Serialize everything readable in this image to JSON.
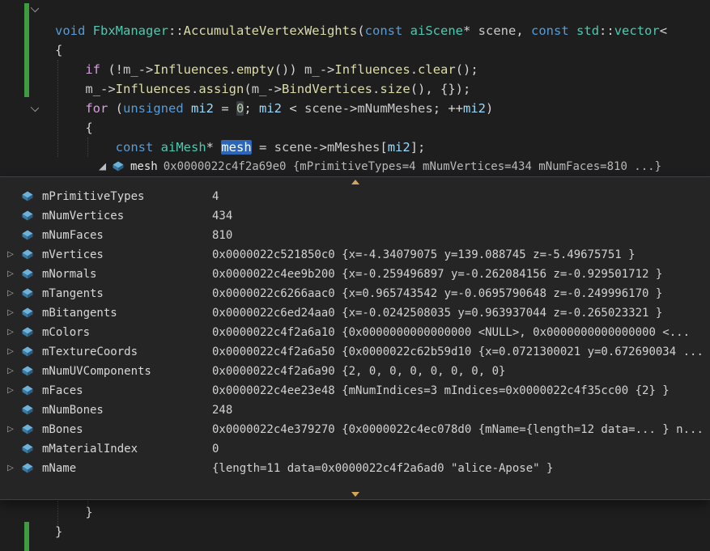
{
  "colors": {
    "editor_bg": "#1e1e1e",
    "popup_bg": "#252526",
    "popup_border": "#3f3f46",
    "change_bar_green": "#3f9b3f",
    "scroll_arrow_orange": "#d6a35c",
    "selection_highlight_blue": "#2b66b8",
    "keyword_blue": "#569cd6",
    "control_keyword_purple": "#d8a0df",
    "type_teal": "#4ec9b0",
    "function_yellow": "#dcdcaa",
    "local_var_blue": "#9cdcfe",
    "number_green": "#b5cea8"
  },
  "editor": {
    "top_lines": [
      {
        "tokens": [
          {
            "t": "void",
            "c": "kw"
          },
          {
            "t": " ",
            "c": "pl"
          },
          {
            "t": "FbxManager",
            "c": "type"
          },
          {
            "t": "::",
            "c": "pl"
          },
          {
            "t": "AccumulateVertexWeights",
            "c": "fn"
          },
          {
            "t": "(",
            "c": "pl"
          },
          {
            "t": "const",
            "c": "kw"
          },
          {
            "t": " ",
            "c": "pl"
          },
          {
            "t": "aiScene",
            "c": "type"
          },
          {
            "t": "* ",
            "c": "pl"
          },
          {
            "t": "scene",
            "c": "id"
          },
          {
            "t": ", ",
            "c": "pl"
          },
          {
            "t": "const",
            "c": "kw"
          },
          {
            "t": " ",
            "c": "pl"
          },
          {
            "t": "std",
            "c": "type"
          },
          {
            "t": "::",
            "c": "pl"
          },
          {
            "t": "vector",
            "c": "type"
          },
          {
            "t": "<",
            "c": "pl"
          }
        ]
      },
      {
        "tokens": [
          {
            "t": "{",
            "c": "pl"
          }
        ]
      },
      {
        "tokens": [
          {
            "t": "    ",
            "c": "pl"
          },
          {
            "t": "if",
            "c": "ctrl"
          },
          {
            "t": " (!",
            "c": "pl"
          },
          {
            "t": "m_",
            "c": "id"
          },
          {
            "t": "->",
            "c": "pl"
          },
          {
            "t": "Influences",
            "c": "fn"
          },
          {
            "t": ".",
            "c": "pl"
          },
          {
            "t": "empty",
            "c": "fn"
          },
          {
            "t": "()) ",
            "c": "pl"
          },
          {
            "t": "m_",
            "c": "id"
          },
          {
            "t": "->",
            "c": "pl"
          },
          {
            "t": "Influences",
            "c": "fn"
          },
          {
            "t": ".",
            "c": "pl"
          },
          {
            "t": "clear",
            "c": "fn"
          },
          {
            "t": "();",
            "c": "pl"
          }
        ]
      },
      {
        "tokens": [
          {
            "t": "    ",
            "c": "pl"
          },
          {
            "t": "m_",
            "c": "id"
          },
          {
            "t": "->",
            "c": "pl"
          },
          {
            "t": "Influences",
            "c": "fn"
          },
          {
            "t": ".",
            "c": "pl"
          },
          {
            "t": "assign",
            "c": "fn"
          },
          {
            "t": "(",
            "c": "pl"
          },
          {
            "t": "m_",
            "c": "id"
          },
          {
            "t": "->",
            "c": "pl"
          },
          {
            "t": "BindVertices",
            "c": "fn"
          },
          {
            "t": ".",
            "c": "pl"
          },
          {
            "t": "size",
            "c": "fn"
          },
          {
            "t": "(), {});",
            "c": "pl"
          }
        ]
      },
      {
        "tokens": [
          {
            "t": "    ",
            "c": "pl"
          },
          {
            "t": "for",
            "c": "ctrl"
          },
          {
            "t": " (",
            "c": "pl"
          },
          {
            "t": "unsigned",
            "c": "kw"
          },
          {
            "t": " ",
            "c": "pl"
          },
          {
            "t": "mi2",
            "c": "var"
          },
          {
            "t": " = ",
            "c": "pl"
          },
          {
            "t": "0",
            "c": "numhl"
          },
          {
            "t": "; ",
            "c": "pl"
          },
          {
            "t": "mi2",
            "c": "var"
          },
          {
            "t": " < ",
            "c": "pl"
          },
          {
            "t": "scene",
            "c": "id"
          },
          {
            "t": "->",
            "c": "pl"
          },
          {
            "t": "mNumMeshes",
            "c": "id"
          },
          {
            "t": "; ++",
            "c": "pl"
          },
          {
            "t": "mi2",
            "c": "var"
          },
          {
            "t": ")",
            "c": "pl"
          }
        ]
      },
      {
        "tokens": [
          {
            "t": "    {",
            "c": "pl"
          }
        ]
      },
      {
        "tokens": [
          {
            "t": "        ",
            "c": "pl"
          },
          {
            "t": "const",
            "c": "kw"
          },
          {
            "t": " ",
            "c": "pl"
          },
          {
            "t": "aiMesh",
            "c": "type"
          },
          {
            "t": "* ",
            "c": "pl"
          },
          {
            "t": "mesh",
            "c": "sel"
          },
          {
            "t": " = ",
            "c": "pl"
          },
          {
            "t": "scene",
            "c": "id"
          },
          {
            "t": "->",
            "c": "pl"
          },
          {
            "t": "mMeshes",
            "c": "id"
          },
          {
            "t": "[",
            "c": "pl"
          },
          {
            "t": "mi2",
            "c": "var"
          },
          {
            "t": "];",
            "c": "pl"
          }
        ]
      }
    ],
    "bottom_lines": [
      {
        "tokens": [
          {
            "t": "    }",
            "c": "pl"
          }
        ]
      },
      {
        "tokens": [
          {
            "t": "}",
            "c": "pl"
          }
        ]
      }
    ]
  },
  "datatip": {
    "header": {
      "name": "mesh",
      "value": "0x0000022c4f2a69e0 {mPrimitiveTypes=4 mNumVertices=434 mNumFaces=810 ...}"
    },
    "icons": {
      "member_icon": "struct-icon",
      "expander_collapsed": "▷",
      "expander_expanded": "lower-right-filled-triangle",
      "scroll_up": "triangle-up",
      "scroll_down": "triangle-down",
      "fold_marker": "chevron-down"
    },
    "members": [
      {
        "name": "mPrimitiveTypes",
        "value": "4",
        "expandable": false
      },
      {
        "name": "mNumVertices",
        "value": "434",
        "expandable": false
      },
      {
        "name": "mNumFaces",
        "value": "810",
        "expandable": false
      },
      {
        "name": "mVertices",
        "value": "0x0000022c521850c0 {x=-4.34079075 y=139.088745 z=-5.49675751 }",
        "expandable": true
      },
      {
        "name": "mNormals",
        "value": "0x0000022c4ee9b200 {x=-0.259496897 y=-0.262084156 z=-0.929501712 }",
        "expandable": true
      },
      {
        "name": "mTangents",
        "value": "0x0000022c6266aac0 {x=0.965743542 y=-0.0695790648 z=-0.249996170 }",
        "expandable": true
      },
      {
        "name": "mBitangents",
        "value": "0x0000022c6ed24aa0 {x=-0.0242508035 y=0.963937044 z=-0.265023321 }",
        "expandable": true
      },
      {
        "name": "mColors",
        "value": "0x0000022c4f2a6a10 {0x0000000000000000 <NULL>, 0x0000000000000000 <...",
        "expandable": true
      },
      {
        "name": "mTextureCoords",
        "value": "0x0000022c4f2a6a50 {0x0000022c62b59d10 {x=0.0721300021 y=0.672690034 ...",
        "expandable": true
      },
      {
        "name": "mNumUVComponents",
        "value": "0x0000022c4f2a6a90 {2, 0, 0, 0, 0, 0, 0, 0}",
        "expandable": true
      },
      {
        "name": "mFaces",
        "value": "0x0000022c4ee23e48 {mNumIndices=3 mIndices=0x0000022c4f35cc00 {2} }",
        "expandable": true
      },
      {
        "name": "mNumBones",
        "value": "248",
        "expandable": false
      },
      {
        "name": "mBones",
        "value": "0x0000022c4e379270 {0x0000022c4ec078d0 {mName={length=12 data=... } n...",
        "expandable": true
      },
      {
        "name": "mMaterialIndex",
        "value": "0",
        "expandable": false
      },
      {
        "name": "mName",
        "value": "{length=11 data=0x0000022c4f2a6ad0 \"alice-Apose\" }",
        "expandable": true
      }
    ]
  }
}
